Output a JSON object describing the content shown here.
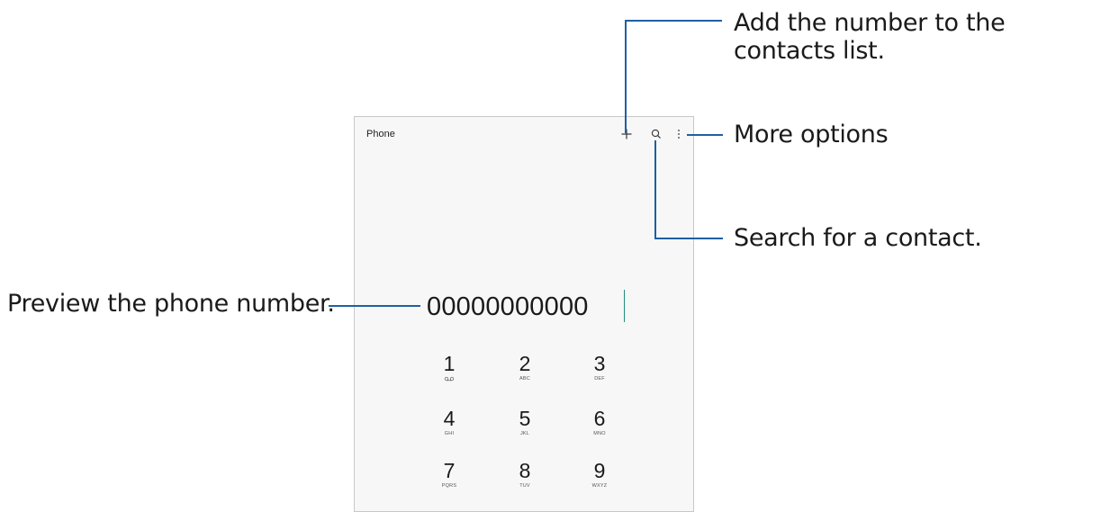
{
  "app": {
    "title": "Phone"
  },
  "toolbar": {
    "add_icon": "plus-icon",
    "search_icon": "search-icon",
    "more_icon": "more-vertical-icon"
  },
  "dialer": {
    "number": "00000000000",
    "keys": [
      {
        "digit": "1",
        "letters": "℥"
      },
      {
        "digit": "2",
        "letters": "ABC"
      },
      {
        "digit": "3",
        "letters": "DEF"
      },
      {
        "digit": "4",
        "letters": "GHI"
      },
      {
        "digit": "5",
        "letters": "JKL"
      },
      {
        "digit": "6",
        "letters": "MNO"
      },
      {
        "digit": "7",
        "letters": "PQRS"
      },
      {
        "digit": "8",
        "letters": "TUV"
      },
      {
        "digit": "9",
        "letters": "WXYZ"
      }
    ]
  },
  "callouts": {
    "add_contact": "Add the number to the contacts list.",
    "more_options": "More options",
    "search_contact": "Search for a contact.",
    "preview_number": "Preview the phone number."
  },
  "colors": {
    "callout_line": "#1f5fa3",
    "caret": "#1f8f7a"
  }
}
